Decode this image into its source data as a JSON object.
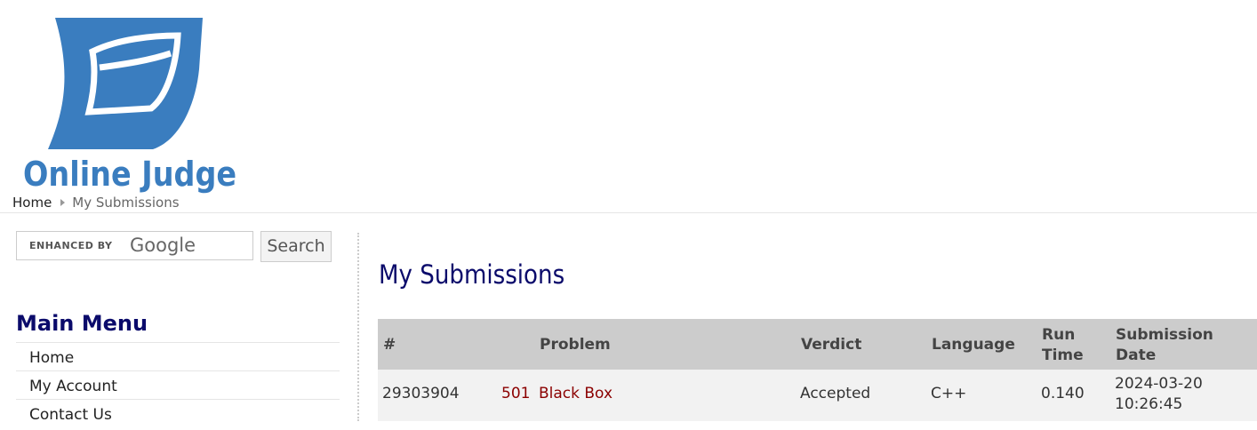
{
  "logo": {
    "text": "Online Judge",
    "color": "#3a7dbf"
  },
  "breadcrumb": {
    "home": "Home",
    "current": "My Submissions"
  },
  "search": {
    "enhanced_by": "ENHANCED BY",
    "google": "Google",
    "button": "Search"
  },
  "menu": {
    "title": "Main Menu",
    "items": [
      "Home",
      "My Account",
      "Contact Us"
    ]
  },
  "page_title": "My Submissions",
  "table": {
    "headers": {
      "id": "#",
      "problem": "Problem",
      "verdict": "Verdict",
      "language": "Language",
      "run_time_1": "Run",
      "run_time_2": "Time",
      "date_1": "Submission",
      "date_2": "Date"
    },
    "rows": [
      {
        "id": "29303904",
        "problem_number": "501",
        "problem_name": "Black Box",
        "verdict": "Accepted",
        "language": "C++",
        "run_time": "0.140",
        "date": "2024-03-20",
        "time": "10:26:45"
      }
    ]
  }
}
